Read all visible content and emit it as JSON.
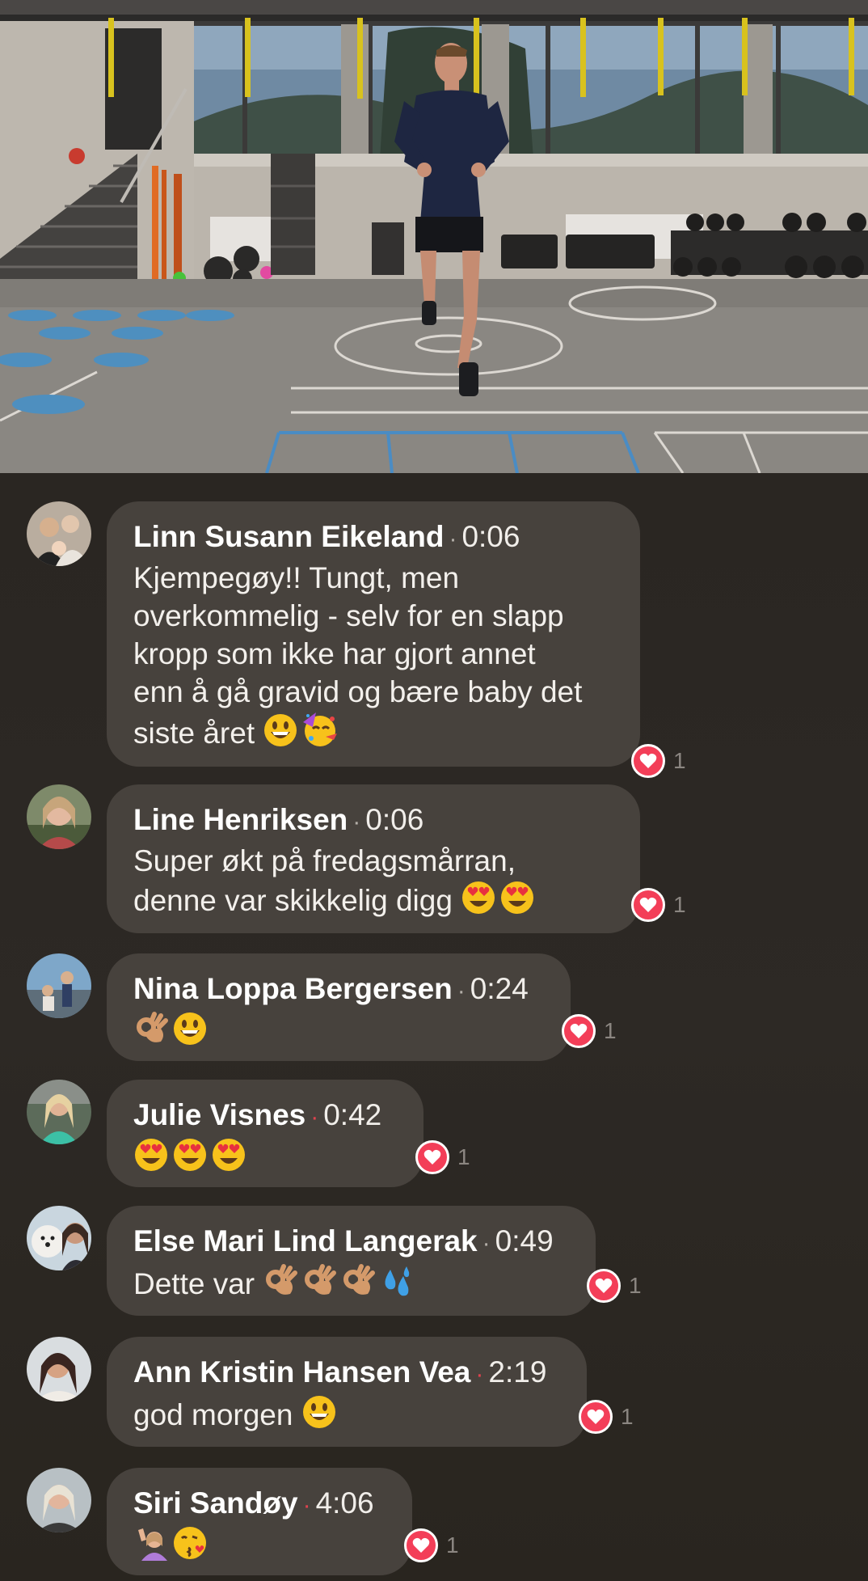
{
  "video": {
    "description_icon": "live-video-frame"
  },
  "comments": [
    {
      "name": "Linn Susann Eikeland",
      "separator": "·",
      "time": "0:06",
      "lines": [
        "Kjempegøy!! Tungt, men",
        "overkommelig - selv for en slapp",
        "kropp som ikke har gjort annet",
        "enn å gå gravid og bære baby det",
        "siste året"
      ],
      "emojis": [
        "grinning-face",
        "partying-face"
      ],
      "reaction_icon": "heart-icon",
      "reaction_count": "1"
    },
    {
      "name": "Line Henriksen",
      "separator": "·",
      "time": "0:06",
      "lines": [
        "Super økt på fredagsmårran,",
        "denne var skikkelig digg"
      ],
      "emojis": [
        "heart-eyes",
        "heart-eyes"
      ],
      "reaction_icon": "heart-icon",
      "reaction_count": "1"
    },
    {
      "name": "Nina Loppa Bergersen",
      "separator": "·",
      "time": "0:24",
      "lines": [
        ""
      ],
      "emojis": [
        "ok-hand",
        "grinning-face"
      ],
      "reaction_icon": "heart-icon",
      "reaction_count": "1"
    },
    {
      "name": "Julie Visnes",
      "separator": "·",
      "time": "0:42",
      "lines": [
        ""
      ],
      "emojis": [
        "heart-eyes",
        "heart-eyes",
        "heart-eyes"
      ],
      "reaction_icon": "heart-icon",
      "reaction_count": "1"
    },
    {
      "name": "Else Mari Lind Langerak",
      "separator": "·",
      "time": "0:49",
      "lines": [
        "Dette var"
      ],
      "emojis": [
        "ok-hand",
        "ok-hand",
        "ok-hand",
        "sweat-droplets"
      ],
      "reaction_icon": "heart-icon",
      "reaction_count": "1"
    },
    {
      "name": "Ann Kristin Hansen Vea",
      "separator": "·",
      "time": "2:19",
      "lines": [
        "god morgen"
      ],
      "emojis": [
        "grinning-face"
      ],
      "reaction_icon": "heart-icon",
      "reaction_count": "1"
    },
    {
      "name": "Siri Sandøy",
      "separator": "·",
      "time": "4:06",
      "lines": [
        ""
      ],
      "emojis": [
        "raising-hand",
        "kissing-heart"
      ],
      "reaction_icon": "heart-icon",
      "reaction_count": "1"
    }
  ],
  "colors": {
    "background": "#2b2723",
    "bubble": "#47423d",
    "heart": "#f33e58",
    "separator_red": "#e0424e"
  }
}
